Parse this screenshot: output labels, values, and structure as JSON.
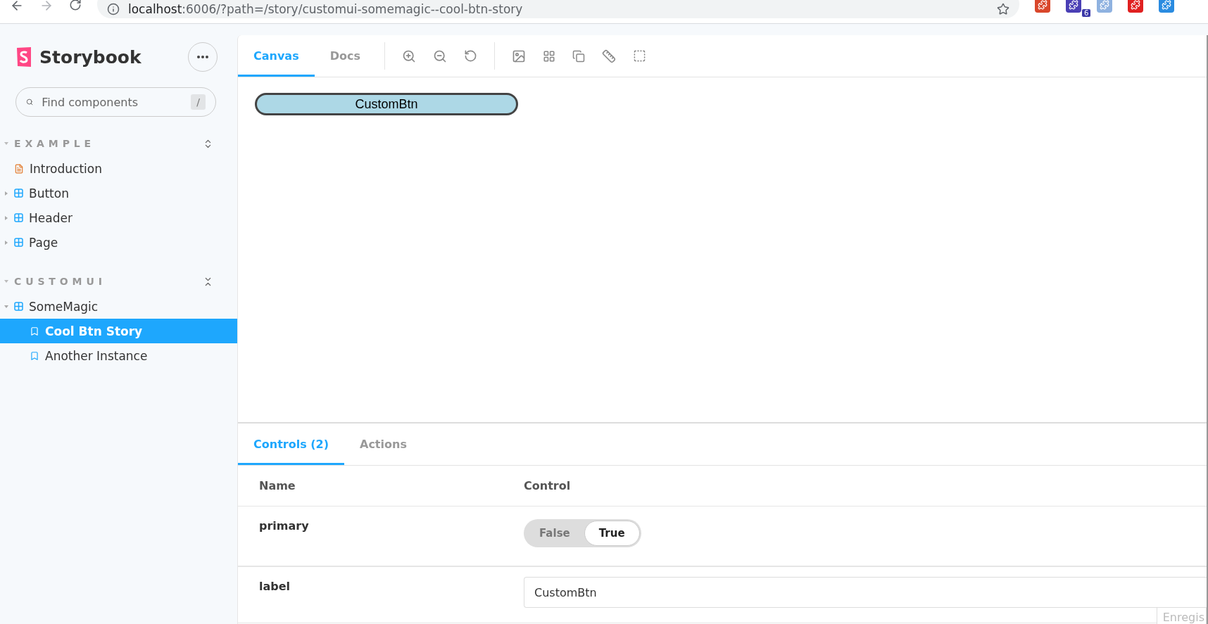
{
  "browser": {
    "url_host": "localhost",
    "url_path": ":6006/?path=/story/customui-somemagic--cool-btn-story",
    "extensions": [
      {
        "color": "#d9472b"
      },
      {
        "color": "#4a3fb5",
        "badge": "6"
      },
      {
        "color": "#8fb2e0"
      },
      {
        "color": "#e02020"
      },
      {
        "color": "#2a8be0"
      }
    ]
  },
  "sidebar": {
    "title": "Storybook",
    "search": {
      "placeholder": "Find components",
      "shortcut": "/"
    },
    "groups": [
      {
        "title": "EXAMPLE",
        "expanded": true,
        "all_expanded": false,
        "items": [
          {
            "label": "Introduction",
            "kind": "doc",
            "selected": false
          },
          {
            "label": "Button",
            "kind": "component",
            "expanded": false,
            "selected": false
          },
          {
            "label": "Header",
            "kind": "component",
            "expanded": false,
            "selected": false
          },
          {
            "label": "Page",
            "kind": "component",
            "expanded": false,
            "selected": false
          }
        ]
      },
      {
        "title": "CUSTOMUI",
        "expanded": true,
        "all_expanded": true,
        "items": [
          {
            "label": "SomeMagic",
            "kind": "component",
            "expanded": true,
            "selected": false,
            "children": [
              {
                "label": "Cool Btn Story",
                "kind": "story",
                "selected": true
              },
              {
                "label": "Another Instance",
                "kind": "story",
                "selected": false
              }
            ]
          }
        ]
      }
    ]
  },
  "toolbar": {
    "tabs": [
      {
        "label": "Canvas",
        "selected": true
      },
      {
        "label": "Docs",
        "selected": false
      }
    ]
  },
  "preview": {
    "button_label": "CustomBtn"
  },
  "addons": {
    "tabs": [
      {
        "label": "Controls (2)",
        "selected": true
      },
      {
        "label": "Actions",
        "selected": false
      }
    ],
    "columns": [
      "Name",
      "Control"
    ],
    "rows": [
      {
        "name": "primary",
        "kind": "boolean",
        "options": [
          {
            "label": "False",
            "selected": false
          },
          {
            "label": "True",
            "selected": true
          }
        ]
      },
      {
        "name": "label",
        "kind": "text",
        "value": "CustomBtn"
      }
    ]
  },
  "overlay": {
    "text": "Enregis"
  }
}
